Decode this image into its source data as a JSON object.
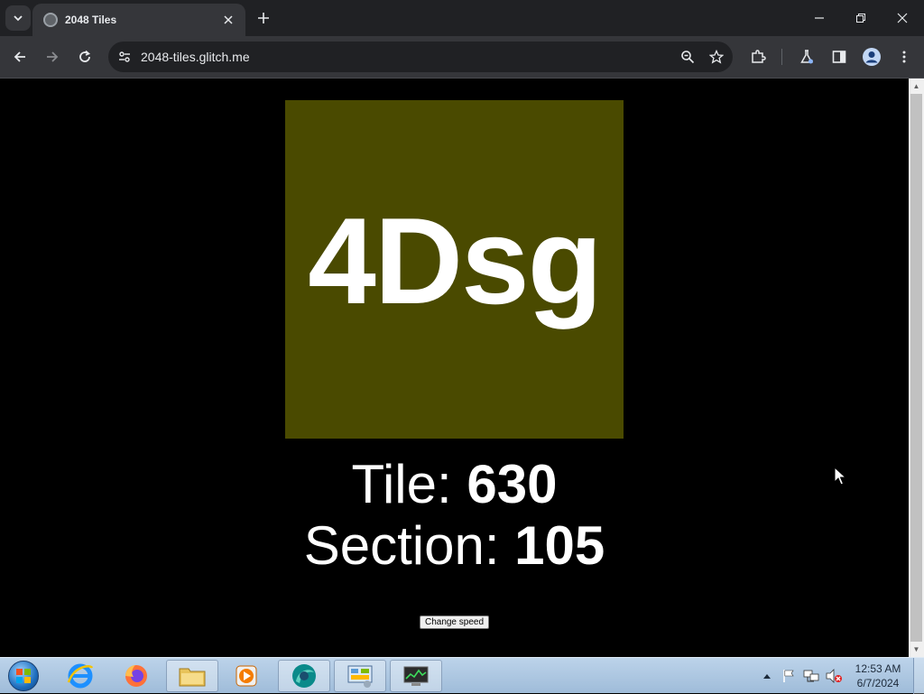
{
  "browser": {
    "tab_title": "2048 Tiles",
    "url": "2048-tiles.glitch.me"
  },
  "page": {
    "tile_label": "4Dsg",
    "tile_color": "#4a4a00",
    "tile_line_label": "Tile: ",
    "tile_number": "630",
    "section_line_label": "Section: ",
    "section_number": "105",
    "change_speed_label": "Change speed"
  },
  "taskbar": {
    "clock_time": "12:53 AM",
    "clock_date": "6/7/2024",
    "pinned": [
      "internet-explorer-icon",
      "firefox-icon",
      "file-explorer-icon",
      "media-player-icon",
      "browser-app-icon",
      "control-panel-icon",
      "task-manager-icon"
    ]
  }
}
